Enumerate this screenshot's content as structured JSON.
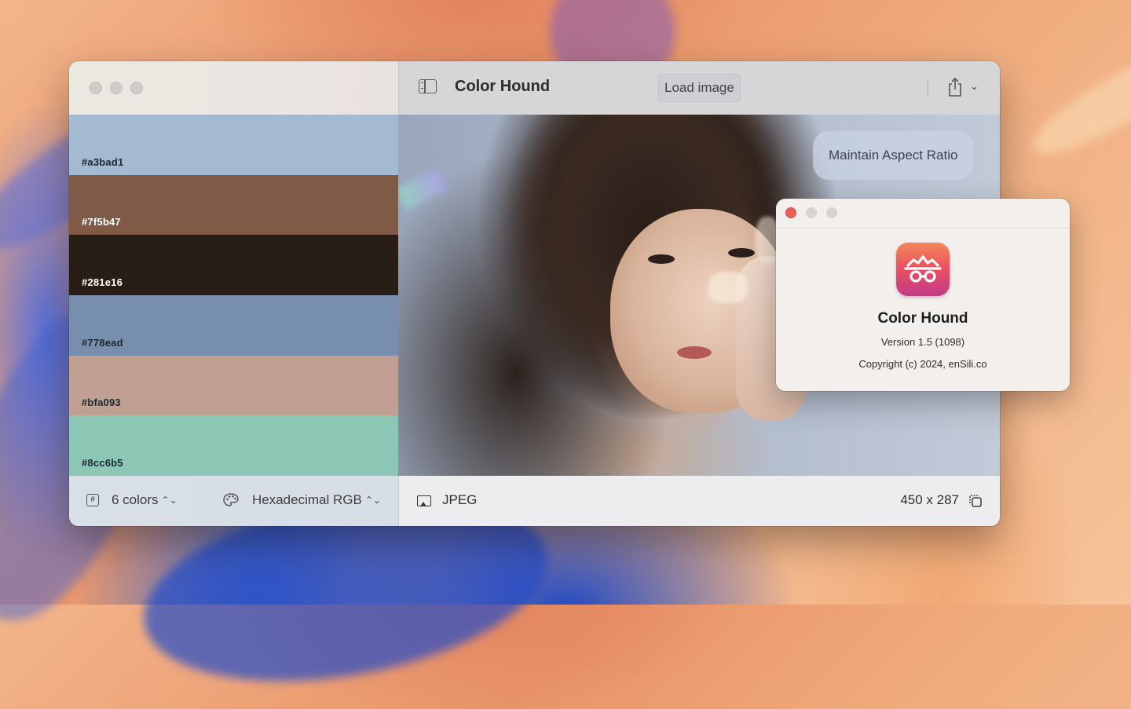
{
  "window": {
    "title": "Color Hound",
    "load_button": "Load image",
    "aspect_button": "Maintain Aspect Ratio"
  },
  "palette": {
    "swatches": [
      {
        "hex": "#a3bad1",
        "color": "#a3bad1",
        "text_color": "#1e2630"
      },
      {
        "hex": "#7f5b47",
        "color": "#7f5b47",
        "text_color": "#ffffff"
      },
      {
        "hex": "#281e16",
        "color": "#281e16",
        "text_color": "#ffffff"
      },
      {
        "hex": "#778ead",
        "color": "#778ead",
        "text_color": "#1e2630"
      },
      {
        "hex": "#bfa093",
        "color": "#bfa093",
        "text_color": "#1e2630"
      },
      {
        "hex": "#8cc6b5",
        "color": "#8cc6b5",
        "text_color": "#1e2630"
      }
    ]
  },
  "sidebar_footer": {
    "color_count": "6 colors",
    "format": "Hexadecimal RGB",
    "hash_symbol": "#"
  },
  "image_footer": {
    "file_type": "JPEG",
    "dimensions": "450 x 287"
  },
  "about": {
    "app_name": "Color Hound",
    "version": "Version 1.5 (1098)",
    "copyright": "Copyright (c) 2024, enSili.co"
  },
  "icons": {
    "sidebar_toggle": "sidebar-toggle-icon",
    "share": "share-icon",
    "chevron": "chevron-down-icon",
    "hash": "hash-icon",
    "palette": "palette-icon",
    "photo": "photo-icon",
    "copy": "copy-icon"
  }
}
